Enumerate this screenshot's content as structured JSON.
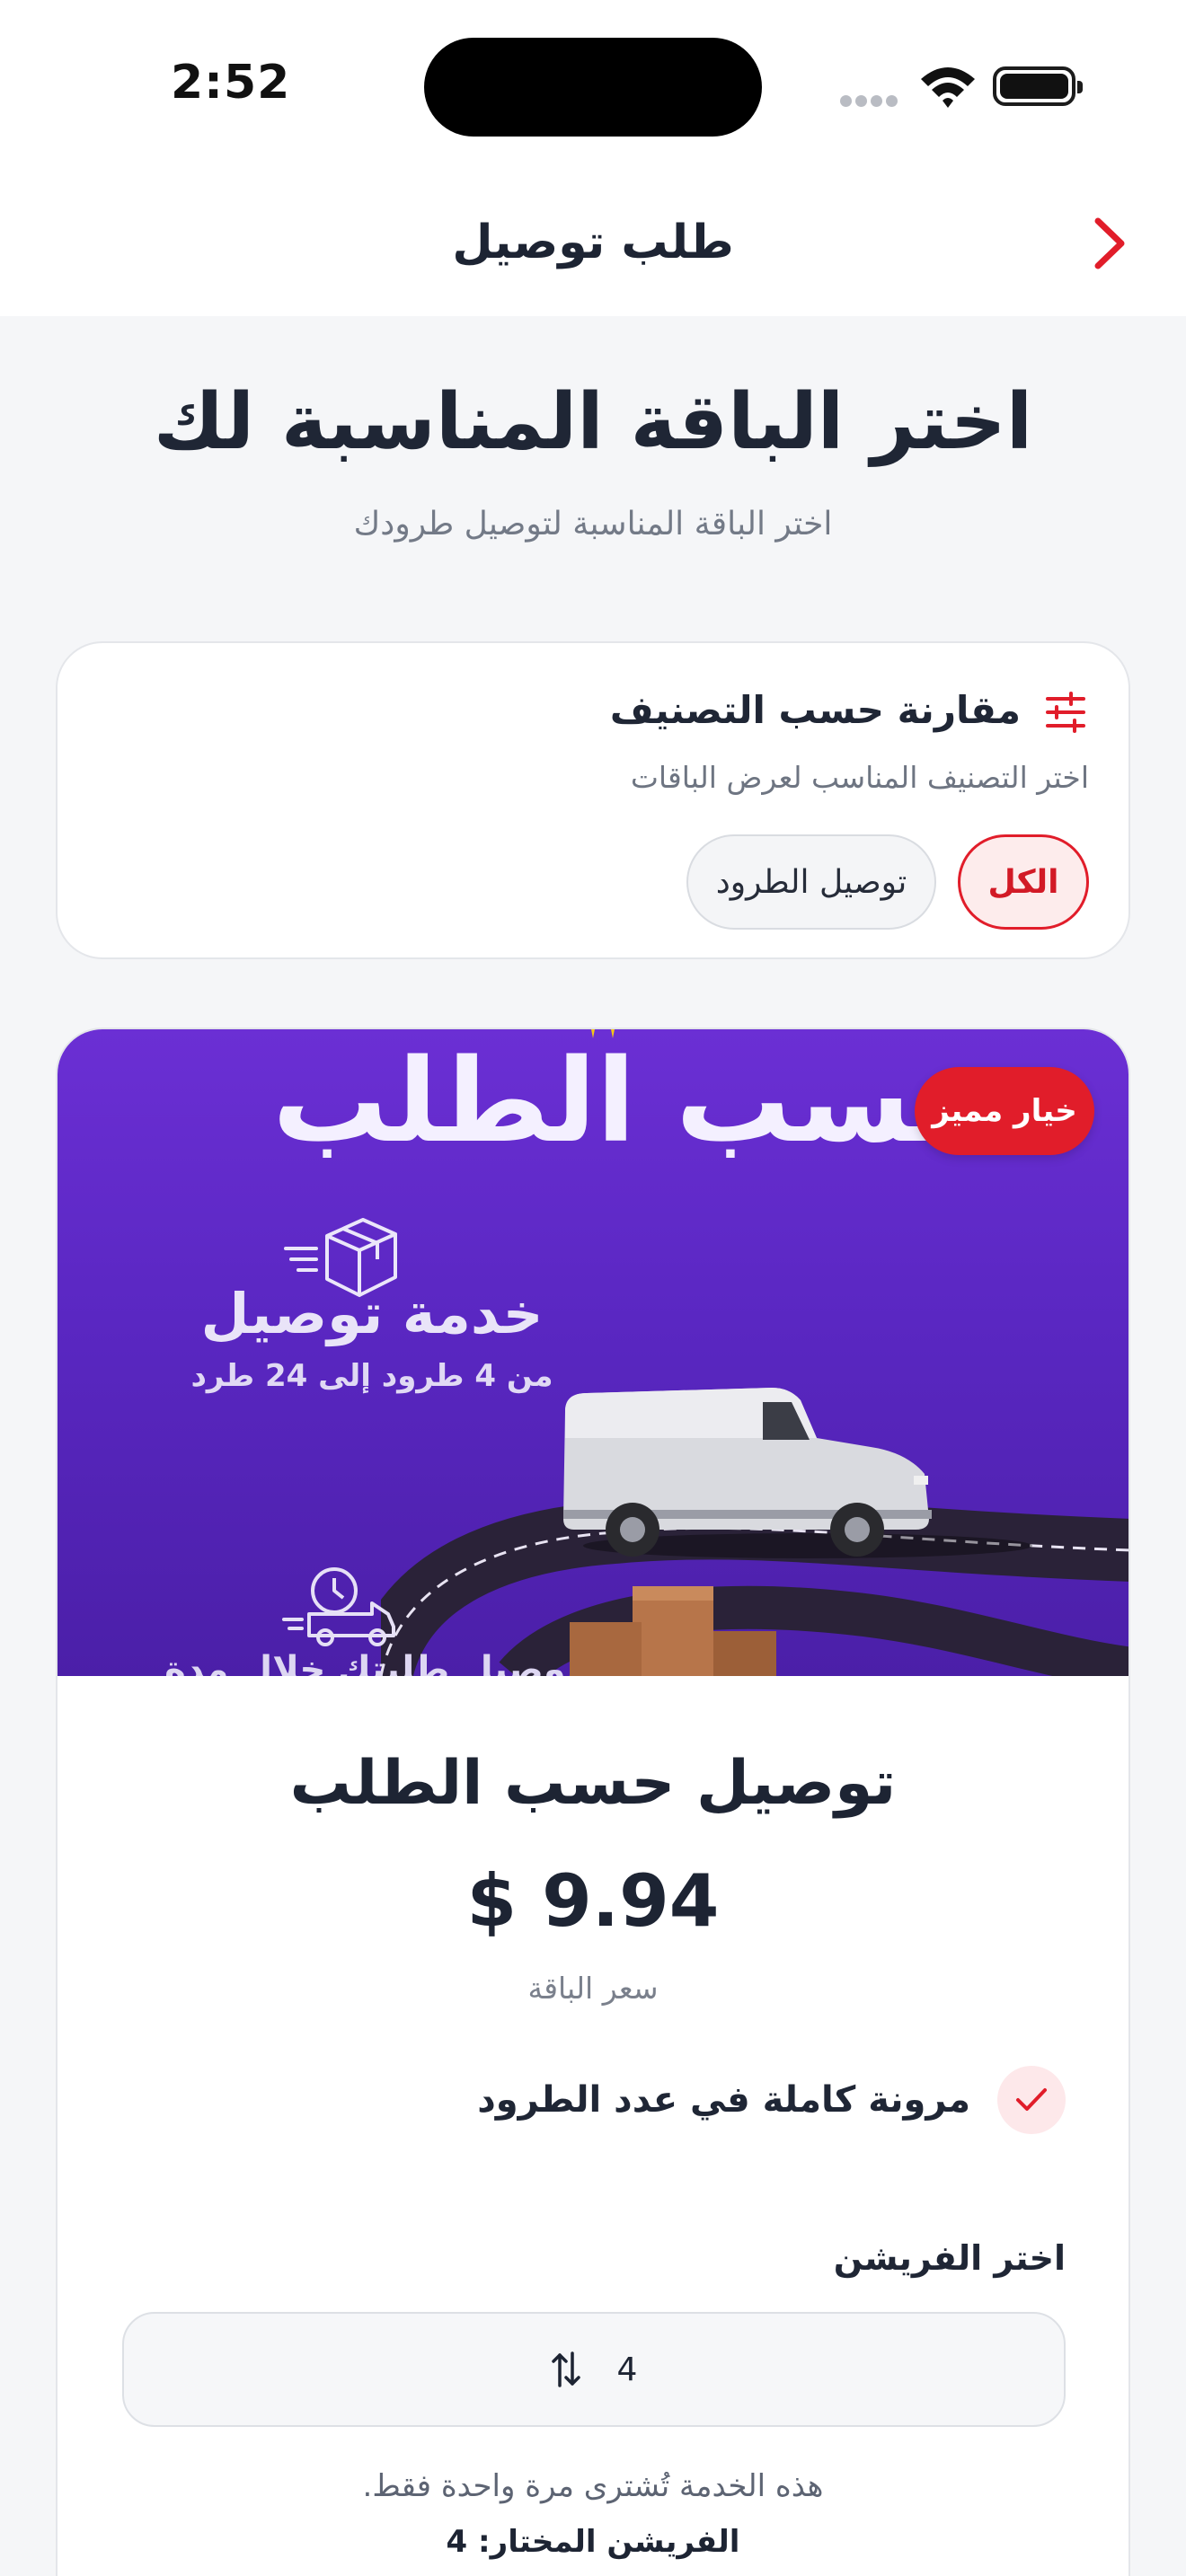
{
  "status_bar": {
    "time": "2:52"
  },
  "nav": {
    "title": "طلب توصيل"
  },
  "header": {
    "title": "اختر الباقة المناسبة لك",
    "subtitle": "اختر الباقة المناسبة لتوصيل طرودك"
  },
  "filter": {
    "title": "مقارنة حسب التصنيف",
    "subtitle": "اختر التصنيف المناسب لعرض الباقات",
    "chips": [
      {
        "label": "الكل",
        "selected": true
      },
      {
        "label": "توصيل الطرود",
        "selected": false
      }
    ]
  },
  "package": {
    "badge": "خيار مميز",
    "banner": {
      "title": "حسب الطلب",
      "service": "خدمة توصيل",
      "range": "من 4 طرود إلى 24 طرد",
      "delivery": "توصيل طلبتك خلال مدة"
    },
    "name": "توصيل حسب الطلب",
    "price": "$ 9.94",
    "price_label": "سعر الباقة",
    "features": [
      "مرونة كاملة في عدد الطرود"
    ],
    "team_label": "اختر الفريشن",
    "team_value": "4",
    "note": "هذه الخدمة تُشترى مرة واحدة فقط.",
    "selected_team": "الفريشن المختار: 4"
  },
  "colors": {
    "accent": "#e11d2a",
    "banner_top": "#6b2fd4",
    "banner_bottom": "#4b1fa8",
    "text": "#1d2433",
    "muted": "#737a87"
  }
}
